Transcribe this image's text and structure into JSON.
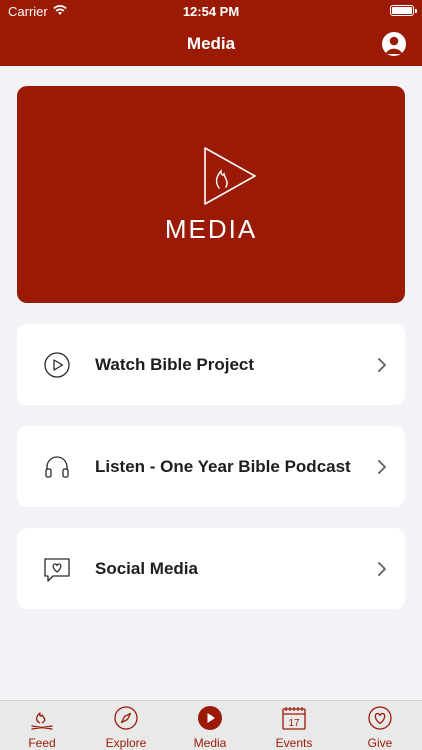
{
  "status_bar": {
    "carrier": "Carrier",
    "time": "12:54 PM"
  },
  "nav": {
    "title": "Media",
    "profile_icon": "profile-icon"
  },
  "hero": {
    "label": "MEDIA",
    "icon": "play-flame-logo"
  },
  "items": [
    {
      "label": "Watch Bible Project",
      "icon": "play-circle-icon"
    },
    {
      "label": "Listen - One Year Bible Podcast",
      "icon": "headphones-icon"
    },
    {
      "label": "Social Media",
      "icon": "chat-heart-icon"
    }
  ],
  "tabs": [
    {
      "label": "Feed",
      "icon": "campfire-icon"
    },
    {
      "label": "Explore",
      "icon": "compass-icon"
    },
    {
      "label": "Media",
      "icon": "play-circle-filled-icon",
      "active": true
    },
    {
      "label": "Events",
      "icon": "calendar-icon"
    },
    {
      "label": "Give",
      "icon": "heart-circle-icon"
    }
  ],
  "colors": {
    "brand": "#9b1a06",
    "background": "#f2f2f7",
    "card": "#ffffff"
  }
}
